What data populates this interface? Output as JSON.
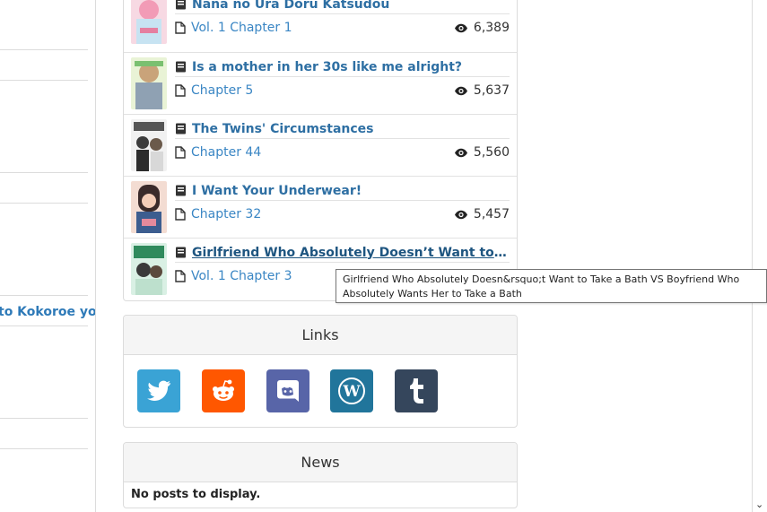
{
  "left_fragment": {
    "text": "to Kokoroe yo"
  },
  "updates": [
    {
      "manga": "Nana no Ura Doru Katsudou",
      "chapter": "Vol. 1 Chapter 1",
      "views": "6,389"
    },
    {
      "manga": "Is a mother in her 30s like me alright?",
      "chapter": "Chapter 5",
      "views": "5,637"
    },
    {
      "manga": "The Twins' Circumstances",
      "chapter": "Chapter 44",
      "views": "5,560"
    },
    {
      "manga": "I Want Your Underwear!",
      "chapter": "Chapter 32",
      "views": "5,457"
    },
    {
      "manga": "Girlfriend Who Absolutely Doesn’t Want to Take a Bath VS Boyfriend Who Absolutely Wants Her to Take a Bath",
      "chapter": "Vol. 1 Chapter 3",
      "views": ""
    }
  ],
  "tooltip": {
    "text": "Girlfriend Who Absolutely Doesn&rsquo;t Want to Take a Bath VS Boyfriend Who Absolutely Wants Her to Take a Bath"
  },
  "links_card": {
    "title": "Links",
    "items": [
      {
        "icon": "twitter-icon",
        "color": "#3aa3d5"
      },
      {
        "icon": "reddit-icon",
        "color": "#ff5700"
      },
      {
        "icon": "discord-icon",
        "color": "#5865a8"
      },
      {
        "icon": "wordpress-icon",
        "color": "#21759b"
      },
      {
        "icon": "tumblr-icon",
        "color": "#35465c"
      }
    ]
  },
  "news_card": {
    "title": "News",
    "empty_text": "No posts to display."
  },
  "colors": {
    "link": "#2e6fa3",
    "chapter_link": "#3a86c4",
    "border": "#dcdcdc"
  }
}
